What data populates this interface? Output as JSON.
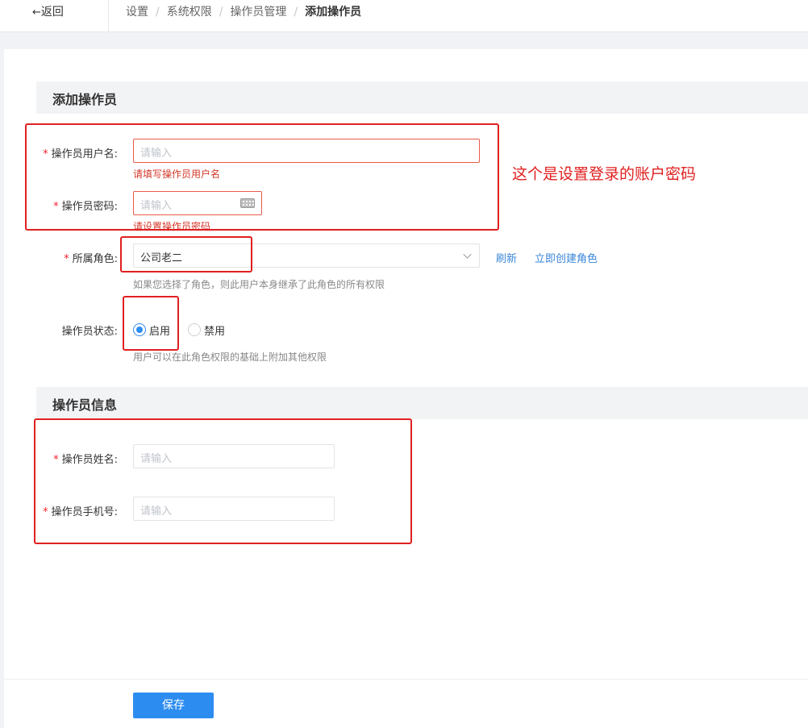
{
  "topbar": {
    "back_label": "返回",
    "breadcrumb": [
      "设置",
      "系统权限",
      "操作员管理",
      "添加操作员"
    ]
  },
  "section_account": {
    "title": "添加操作员",
    "username": {
      "label": "操作员用户名:",
      "placeholder": "请输入",
      "error": "请填写操作员用户名"
    },
    "password": {
      "label": "操作员密码:",
      "placeholder": "请输入",
      "error": "请设置操作员密码"
    },
    "role": {
      "label": "所属角色:",
      "value": "公司老二",
      "refresh_label": "刷新",
      "create_label": "立即创建角色",
      "hint": "如果您选择了角色，则此用户本身继承了此角色的所有权限"
    },
    "status": {
      "label": "操作员状态:",
      "options": [
        {
          "label": "启用",
          "checked": true
        },
        {
          "label": "禁用",
          "checked": false
        }
      ],
      "hint": "用户可以在此角色权限的基础上附加其他权限"
    }
  },
  "section_info": {
    "title": "操作员信息",
    "name": {
      "label": "操作员姓名:",
      "placeholder": "请输入"
    },
    "phone": {
      "label": "操作员手机号:",
      "placeholder": "请输入"
    }
  },
  "annotation": {
    "text": "这个是设置登录的账户密码",
    "color": "#e02020"
  },
  "save_label": "保存",
  "colors": {
    "primary": "#2d8cf0",
    "error": "#d4382a",
    "required": "#f5222d",
    "link": "#3a86d8"
  }
}
